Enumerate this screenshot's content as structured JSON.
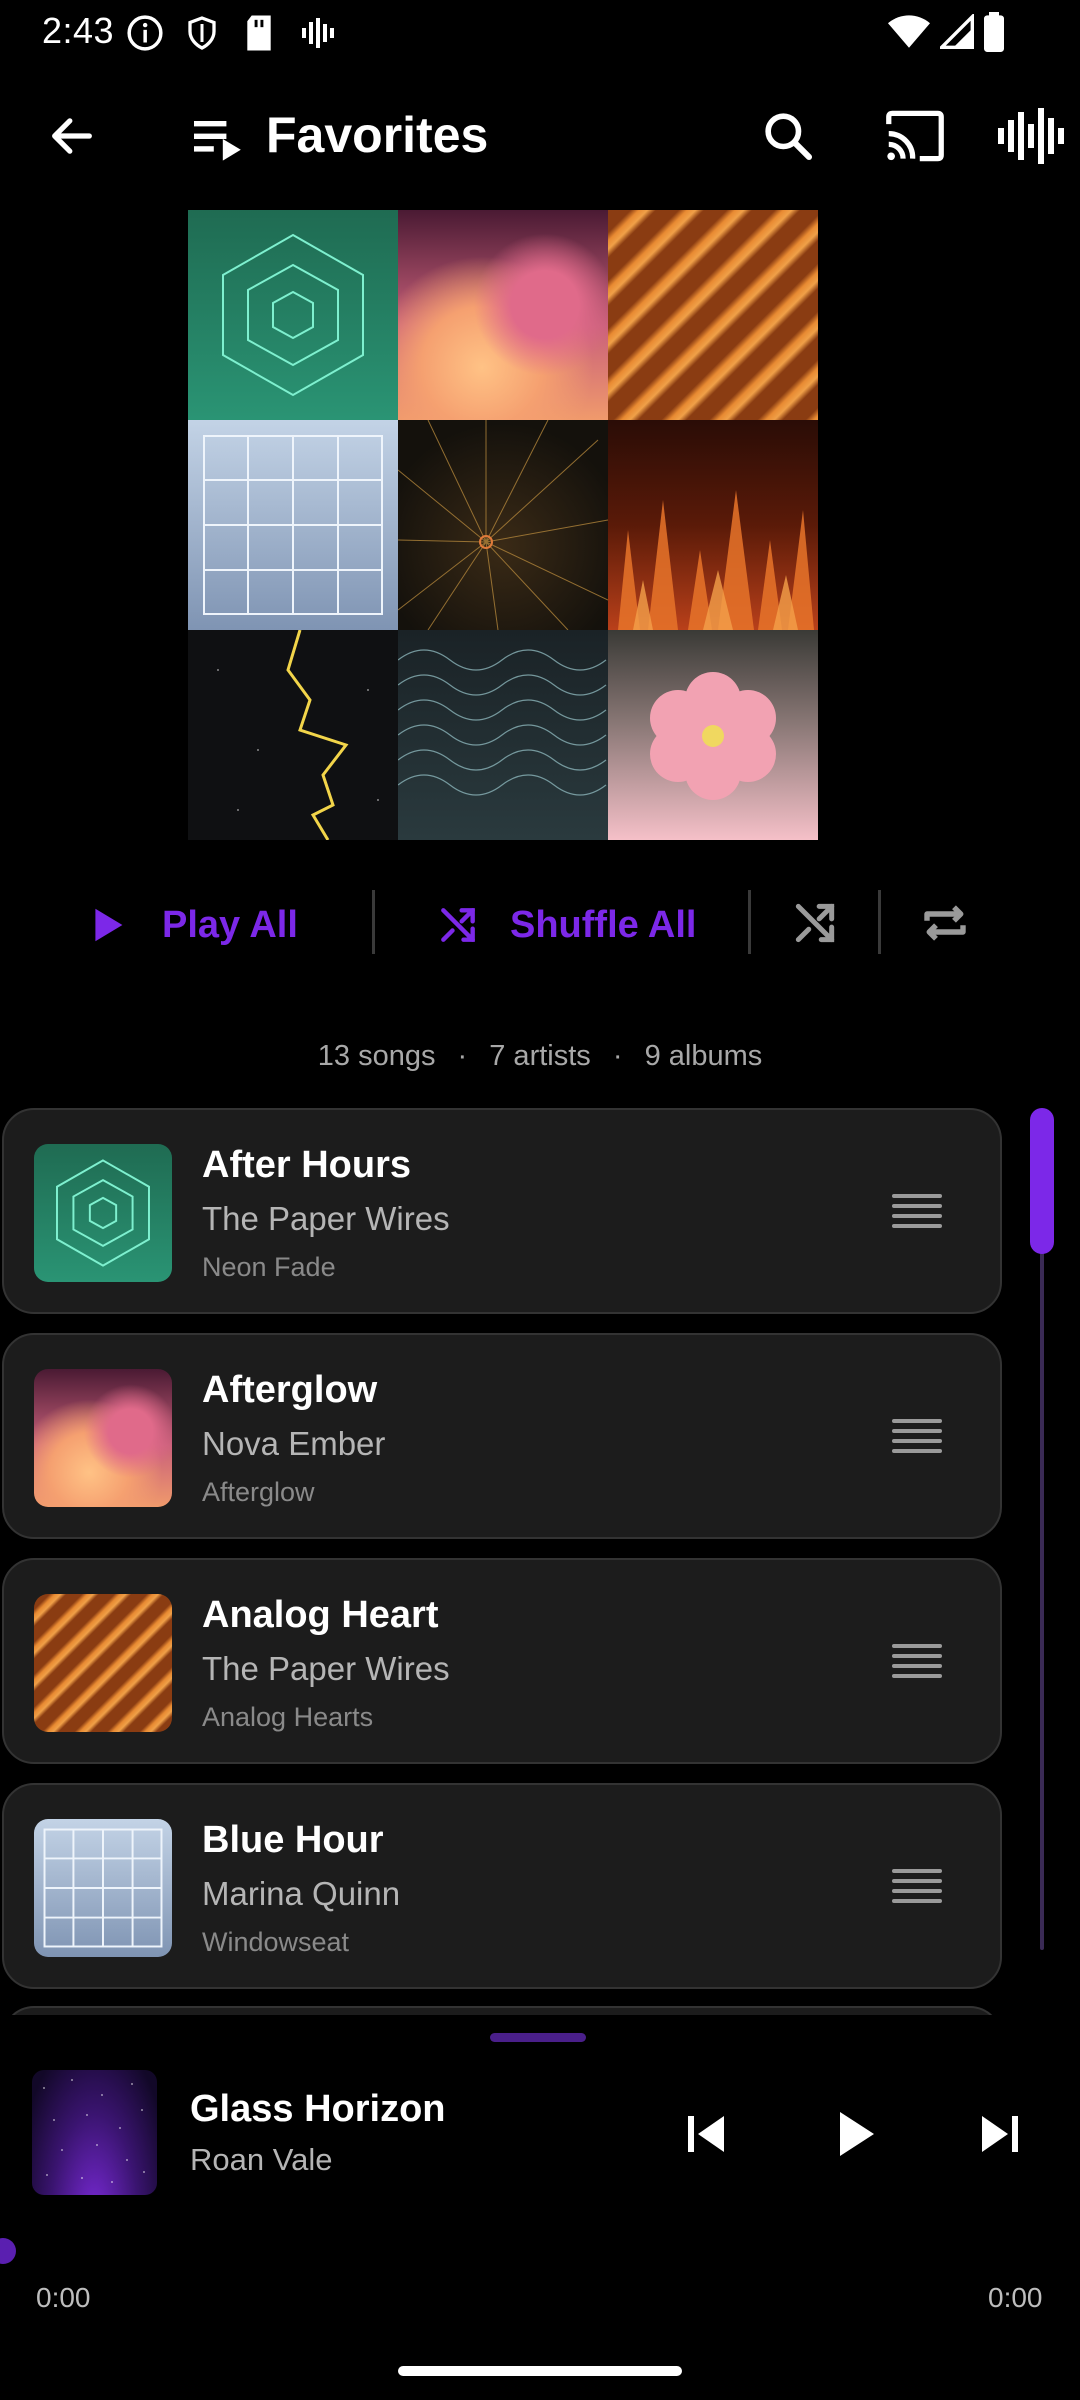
{
  "status_bar": {
    "time": "2:43"
  },
  "top_bar": {
    "title": "Favorites"
  },
  "actions": {
    "play_all": "Play All",
    "shuffle_all": "Shuffle All"
  },
  "summary": {
    "songs": "13 songs",
    "artists": "7 artists",
    "albums": "9 albums",
    "separator": "·"
  },
  "songs": [
    {
      "title": "After Hours",
      "artist": "The Paper Wires",
      "album": "Neon Fade"
    },
    {
      "title": "Afterglow",
      "artist": "Nova Ember",
      "album": "Afterglow"
    },
    {
      "title": "Analog Heart",
      "artist": "The Paper Wires",
      "album": "Analog Hearts"
    },
    {
      "title": "Blue Hour",
      "artist": "Marina Quinn",
      "album": "Windowseat"
    }
  ],
  "now_playing": {
    "title": "Glass Horizon",
    "artist": "Roan Vale",
    "elapsed": "0:00",
    "duration": "0:00",
    "progress": 0
  },
  "colors": {
    "accent": "#7c28e8",
    "card_bg": "#1c1c1c",
    "background": "#000000"
  }
}
